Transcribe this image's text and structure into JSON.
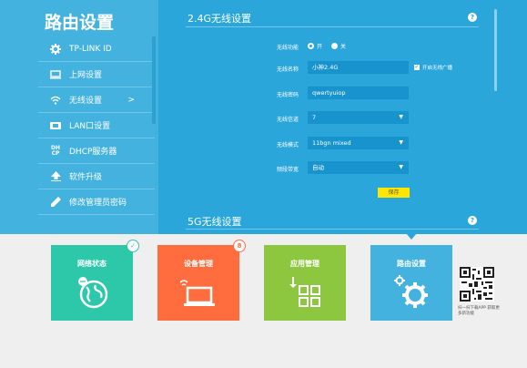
{
  "sidebar": {
    "title": "路由设置",
    "items": [
      {
        "label": "TP-LINK ID"
      },
      {
        "label": "上网设置"
      },
      {
        "label": "无线设置",
        "arrow": ">"
      },
      {
        "label": "LAN口设置"
      },
      {
        "label": "DHCP服务器"
      },
      {
        "label": "软件升级"
      },
      {
        "label": "修改管理员密码"
      }
    ]
  },
  "wireless24": {
    "title": "2.4G无线设置",
    "help": "?",
    "fields": {
      "switch": {
        "label": "无线功能",
        "on": "开",
        "off": "关"
      },
      "ssid": {
        "label": "无线名称",
        "value": "小神2.4G",
        "broadcast": "开启无线广播"
      },
      "password": {
        "label": "无线密码",
        "value": "qwertyuiop"
      },
      "channel": {
        "label": "无线信道",
        "value": "7"
      },
      "mode": {
        "label": "无线模式",
        "value": "11bgn mixed"
      },
      "bandwidth": {
        "label": "频段带宽",
        "value": "自动"
      }
    },
    "save": "保存"
  },
  "wireless5": {
    "title": "5G无线设置",
    "help": "?"
  },
  "tiles": [
    {
      "label": "网络状态",
      "color": "#2dc7a9",
      "badge": "✓"
    },
    {
      "label": "设备管理",
      "color": "#ff6d3f",
      "badge": "8"
    },
    {
      "label": "应用管理",
      "color": "#8dc63f"
    },
    {
      "label": "路由设置",
      "color": "#43b2df"
    }
  ],
  "qr_note": "扫一扫下载APP 获取更多新功能"
}
